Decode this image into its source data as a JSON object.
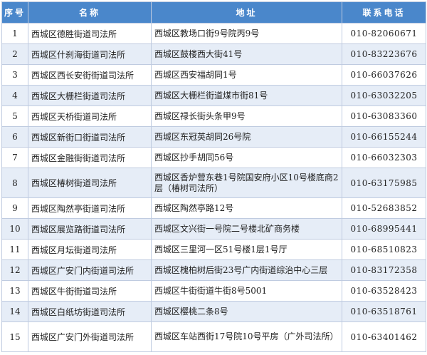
{
  "table": {
    "headers": [
      "序号",
      "名称",
      "地址",
      "联系电话"
    ],
    "rows": [
      {
        "num": "1",
        "name": "西城区德胜街道司法所",
        "address": "西城区教场口街9号院丙9号",
        "phone": "010-82060671"
      },
      {
        "num": "2",
        "name": "西城区什刹海街道司法所",
        "address": "西城区鼓楼西大街41号",
        "phone": "010-83223676"
      },
      {
        "num": "3",
        "name": "西城区西长安街街道司法所",
        "address": "西城区西安福胡同1号",
        "phone": "010-66037626"
      },
      {
        "num": "4",
        "name": "西城区大栅栏街道司法所",
        "address": "西城区大栅栏街道煤市街81号",
        "phone": "010-63032205"
      },
      {
        "num": "5",
        "name": "西城区天桥街道司法所",
        "address": "西城区禄长街头条甲9号",
        "phone": "010-63083360"
      },
      {
        "num": "6",
        "name": "西城区新街口街道司法所",
        "address": "西城区东冠英胡同26号院",
        "phone": "010-66155244"
      },
      {
        "num": "7",
        "name": "西城区金融街街道司法所",
        "address": "西城区抄手胡同56号",
        "phone": "010-66032303"
      },
      {
        "num": "8",
        "name": "西城区椿树街道司法所",
        "address": "西城区香炉营东巷1号院国安府小区10号楼底商2层（椿树司法所）",
        "phone": "010-63175985"
      },
      {
        "num": "9",
        "name": "西城区陶然亭街道司法所",
        "address": "西城区陶然亭路12号",
        "phone": "010-52683852"
      },
      {
        "num": "10",
        "name": "西城区展览路街道司法所",
        "address": "西城区文兴街一号院二号楼北矿商务楼",
        "phone": "010-68995441"
      },
      {
        "num": "11",
        "name": "西城区月坛街道司法所",
        "address": "西城区三里河一区51号楼1层1号厅",
        "phone": "010-68510823"
      },
      {
        "num": "12",
        "name": "西城区广安门内街道司法所",
        "address": "西城区槐柏树后街23号广内街道综治中心三层",
        "phone": "010-83172358"
      },
      {
        "num": "13",
        "name": "西城区牛街街道司法所",
        "address": "西城区牛街街道牛街8号5001",
        "phone": "010-63528423"
      },
      {
        "num": "14",
        "name": "西城区白纸坊街道司法所",
        "address": "西城区樱桃二条8号",
        "phone": "010-63518761"
      },
      {
        "num": "15",
        "name": "西城区广安门外街道司法所",
        "address": "西城区车站西街17号院10号平房（广外司法所）",
        "phone": "010-63401462"
      }
    ]
  },
  "colors": {
    "header_bg": "#4a87cb",
    "header_text": "#ffffff",
    "stripe_bg": "#e6edf7",
    "border": "#bfcbe0"
  }
}
